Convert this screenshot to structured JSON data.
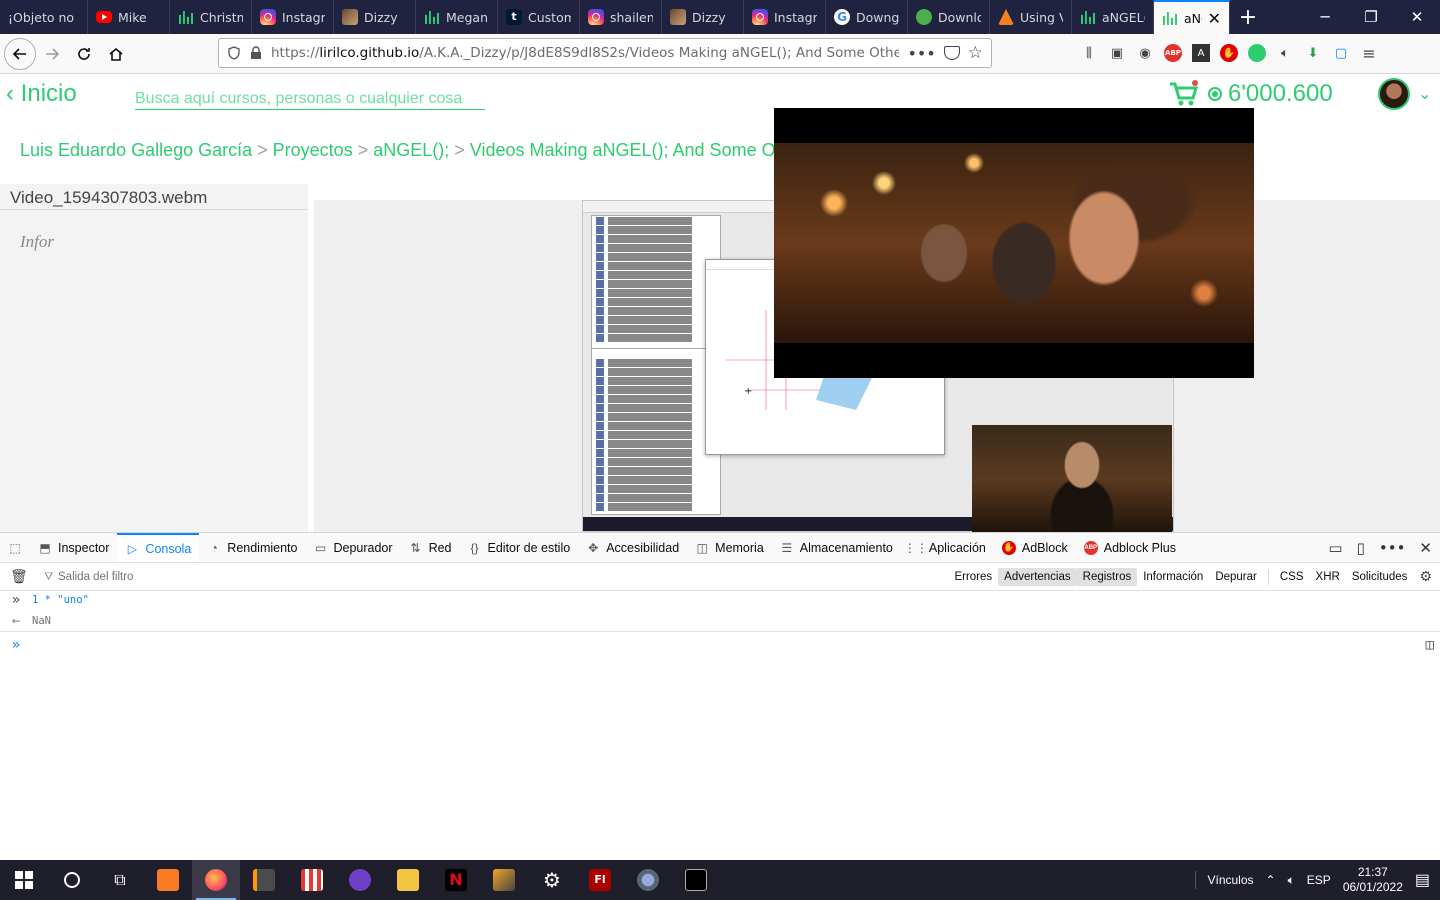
{
  "tabs": [
    {
      "label": "¡Objeto no",
      "icon": "none",
      "active": false
    },
    {
      "label": "Mike",
      "icon": "youtube-icon",
      "active": false
    },
    {
      "label": "Christm",
      "icon": "bars-icon",
      "active": false
    },
    {
      "label": "Instagra",
      "icon": "instagram-icon",
      "active": false
    },
    {
      "label": "Dizzy",
      "icon": "dizzy-icon",
      "active": false
    },
    {
      "label": "Megan",
      "icon": "bars-icon",
      "active": false
    },
    {
      "label": "Custom",
      "icon": "tumblr-icon",
      "active": false
    },
    {
      "label": "shailen",
      "icon": "instagram-icon",
      "active": false
    },
    {
      "label": "Dizzy",
      "icon": "dizzy-icon",
      "active": false
    },
    {
      "label": "Instagra",
      "icon": "instagram-icon",
      "active": false
    },
    {
      "label": "Downg",
      "icon": "google-icon",
      "active": false
    },
    {
      "label": "Downlo",
      "icon": "download-icon",
      "active": false
    },
    {
      "label": "Using V",
      "icon": "stackoverflow-icon",
      "active": false
    },
    {
      "label": "aNGEL(",
      "icon": "bars-icon",
      "active": false
    },
    {
      "label": "aNG",
      "icon": "bars-icon",
      "active": true
    }
  ],
  "url": {
    "prefix": "https://",
    "host": "lirilco.github.io",
    "path": "/A.K.A._Dizzy/p/J8dE8S9dI8S2s/Videos Making aNGEL(); And Some Other Things/"
  },
  "page": {
    "back_label": "Inicio",
    "search_placeholder": "Busca aquí cursos, personas o cualquier cosa",
    "balance": "6'000.600",
    "breadcrumb": [
      "Luis Eduardo Gallego García",
      "Proyectos",
      "aNGEL();",
      "Videos Making aNGEL(); And Some Other Things"
    ],
    "breadcrumb_sep": ">",
    "video_title": "Video_1594307803.webm",
    "info_label": "Infor"
  },
  "devtools": {
    "tabs": [
      {
        "label": "Inspector",
        "icon": "inspector-icon"
      },
      {
        "label": "Consola",
        "icon": "console-icon",
        "active": true
      },
      {
        "label": "Rendimiento",
        "icon": "performance-icon"
      },
      {
        "label": "Depurador",
        "icon": "debugger-icon"
      },
      {
        "label": "Red",
        "icon": "network-icon"
      },
      {
        "label": "Editor de estilo",
        "icon": "style-editor-icon"
      },
      {
        "label": "Accesibilidad",
        "icon": "accessibility-icon"
      },
      {
        "label": "Memoria",
        "icon": "memory-icon"
      },
      {
        "label": "Almacenamiento",
        "icon": "storage-icon"
      },
      {
        "label": "Aplicación",
        "icon": "application-icon"
      },
      {
        "label": "AdBlock",
        "icon": "adblock-icon"
      },
      {
        "label": "Adblock Plus",
        "icon": "abp-icon"
      }
    ],
    "filter_placeholder": "Salida del filtro",
    "filters": [
      {
        "label": "Errores",
        "on": false
      },
      {
        "label": "Advertencias",
        "on": true
      },
      {
        "label": "Registros",
        "on": true
      },
      {
        "label": "Información",
        "on": false
      },
      {
        "label": "Depurar",
        "on": false
      },
      {
        "label": "CSS",
        "on": false
      },
      {
        "label": "XHR",
        "on": false
      },
      {
        "label": "Solicitudes",
        "on": false
      }
    ],
    "console": {
      "input": "1 * \"uno\"",
      "output": "NaN"
    }
  },
  "taskbar": {
    "tray_label": "Vínculos",
    "lang": "ESP",
    "time": "21:37",
    "date": "06/01/2022"
  },
  "colors": {
    "accent": "#2ecc71",
    "tabstrip": "#202340",
    "devtools_active": "#0a84ff",
    "taskbar": "#1f1f2b"
  }
}
